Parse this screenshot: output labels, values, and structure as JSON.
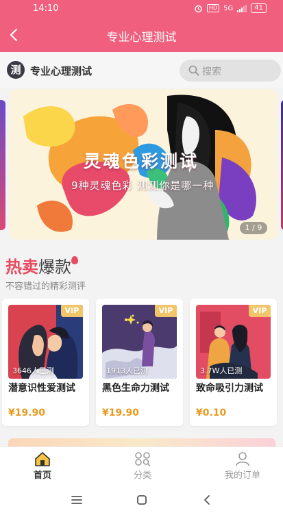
{
  "status": {
    "time": "14:10",
    "network": "5G",
    "hd": "HD",
    "battery": "41"
  },
  "nav": {
    "title": "专业心理测试"
  },
  "brand": {
    "logo_char": "测",
    "name": "专业心理测试"
  },
  "search": {
    "placeholder": "搜索"
  },
  "banner": {
    "title": "灵魂色彩测试",
    "subtitle": "9种灵魂色彩 测测你是哪一种",
    "page_indicator": "1 / 9"
  },
  "section": {
    "title_hot": "热卖",
    "title_rest": "爆款",
    "subtitle": "不容错过的精彩测评"
  },
  "cards": [
    {
      "title": "潜意识性爱测试",
      "count": "3646人已测",
      "price": "¥19.90",
      "badge": "VIP"
    },
    {
      "title": "黑色生命力测试",
      "count": "1913人已测",
      "price": "¥19.90",
      "badge": "VIP"
    },
    {
      "title": "致命吸引力测试",
      "count": "3.7W人已测",
      "price": "¥0.10",
      "badge": "VIP"
    }
  ],
  "tabs": [
    {
      "label": "首页",
      "icon": "home-icon",
      "active": true
    },
    {
      "label": "分类",
      "icon": "category-icon",
      "active": false
    },
    {
      "label": "我的订单",
      "icon": "user-icon",
      "active": false
    }
  ],
  "colors": {
    "brand": "#f0607e",
    "price": "#e89a1f",
    "vip": "#f1c66a",
    "hot": "#e84a5f"
  }
}
